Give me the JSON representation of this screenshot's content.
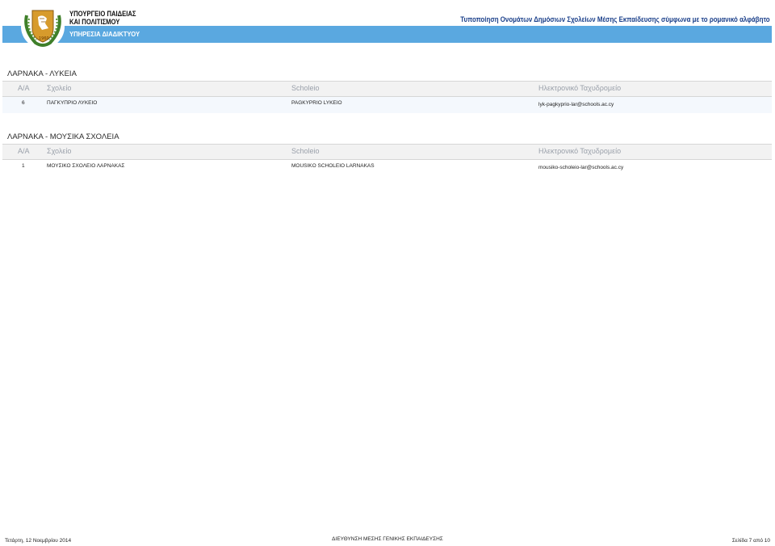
{
  "header": {
    "ministry_line1": "ΥΠΟΥΡΓΕΙΟ ΠΑΙΔΕΙΑΣ",
    "ministry_line2": "ΚΑΙ ΠΟΛΙΤΙΣΜΟΥ",
    "service": "ΥΠΗΡΕΣΙΑ ΔΙΑΔΙΚΤΥΟΥ",
    "document_title": "Τυποποίηση Ονομάτων Δημόσιων Σχολείων Μέσης Εκπαίδευσης σύμφωνα με το ρομανικό αλφάβητο",
    "band_color": "#5aa8e0",
    "logo_icon": "cyprus-coat-of-arms-icon"
  },
  "columns": {
    "num": "Α/Α",
    "school": "Σχολείο",
    "school_latin": "Scholeio",
    "email": "Ηλεκτρονικό Ταχυδρομείο"
  },
  "sections": [
    {
      "title": "ΛΑΡΝΑΚΑ - ΛΥΚΕΙΑ",
      "rows": [
        {
          "num": "6",
          "school": "ΠΑΓΚΥΠΡΙΟ ΛΥΚΕΙΟ",
          "school_latin": "PAGKYPRIO LYKEIO",
          "email": "lyk-pagkyprio-lar@schools.ac.cy"
        }
      ]
    },
    {
      "title": "ΛΑΡΝΑΚΑ - ΜΟΥΣΙΚΑ ΣΧΟΛΕΙΑ",
      "rows": [
        {
          "num": "1",
          "school": "ΜΟΥΣΙΚΟ ΣΧΟΛΕΙΟ ΛΑΡΝΑΚΑΣ",
          "school_latin": "MOUSIKO SCHOLEIO LARNAKAS",
          "email": "mousiko-scholeio-lar@schools.ac.cy"
        }
      ]
    }
  ],
  "footer": {
    "date": "Τετάρτη, 12 Νοεμβρίου 2014",
    "department": "ΔΙΕΥΘΥΝΣΗ ΜΕΣΗΣ ΓΕΝΙΚΗΣ ΕΚΠΑΙΔΕΥΣΗΣ",
    "page": "Σελίδα 7 από 10"
  }
}
